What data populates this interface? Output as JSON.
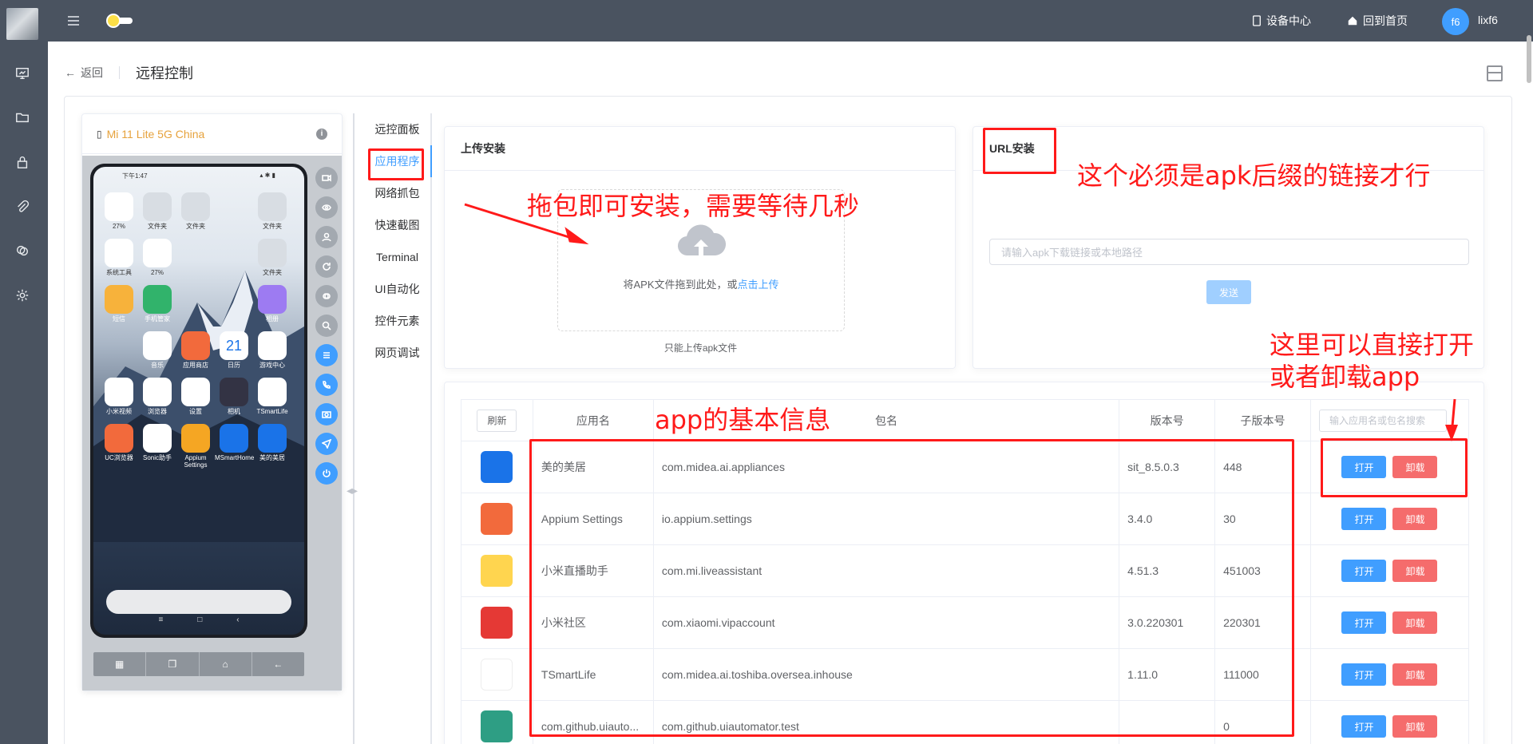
{
  "topbar": {
    "device_center": "设备中心",
    "home": "回到首页",
    "avatar_text": "f6",
    "username": "lixf6"
  },
  "breadcrumb": {
    "back": "返回",
    "title": "远程控制"
  },
  "device": {
    "name": "Mi 11 Lite 5G China",
    "status_time": "下午1:47",
    "apps": [
      {
        "label": "27%"
      },
      {
        "label": "文件夹"
      },
      {
        "label": "文件夹"
      },
      {
        "label": "文件夹"
      },
      {
        "label": "系统工具"
      },
      {
        "label": "27%"
      },
      {
        "label": "文件夹"
      },
      {
        "label": "短信"
      },
      {
        "label": "手机管家"
      },
      {
        "label": "相册"
      },
      {
        "label": "音乐"
      },
      {
        "label": "应用商店"
      },
      {
        "label": "日历"
      },
      {
        "label": "游戏中心"
      },
      {
        "label": "小米视频"
      },
      {
        "label": "浏览器"
      },
      {
        "label": "设置"
      },
      {
        "label": "相机"
      },
      {
        "label": "TSmartLife"
      },
      {
        "label": "UC浏览器"
      },
      {
        "label": "Sonic助手"
      },
      {
        "label": "Appium Settings"
      },
      {
        "label": "MSmartHome"
      },
      {
        "label": "美的美居"
      }
    ],
    "calendar_day": "21"
  },
  "tabs": [
    {
      "label": "远控面板"
    },
    {
      "label": "应用程序"
    },
    {
      "label": "网络抓包"
    },
    {
      "label": "快速截图"
    },
    {
      "label": "Terminal"
    },
    {
      "label": "UI自动化"
    },
    {
      "label": "控件元素"
    },
    {
      "label": "网页调试"
    }
  ],
  "upload": {
    "title": "上传安装",
    "drop_text": "将APK文件拖到此处，或",
    "drop_link": "点击上传",
    "tip": "只能上传apk文件"
  },
  "url_install": {
    "title": "URL安装",
    "placeholder": "请输入apk下载链接或本地路径",
    "send": "发送"
  },
  "table": {
    "refresh": "刷新",
    "headers": {
      "app_name": "应用名",
      "package": "包名",
      "version": "版本号",
      "sub_version": "子版本号"
    },
    "search_placeholder": "输入应用名或包名搜索",
    "open": "打开",
    "uninstall": "卸载",
    "rows": [
      {
        "name": "美的美居",
        "package": "com.midea.ai.appliances",
        "version": "sit_8.5.0.3",
        "sub": "448",
        "color": "#1a73e8"
      },
      {
        "name": "Appium Settings",
        "package": "io.appium.settings",
        "version": "3.4.0",
        "sub": "30",
        "color": "#f26a3c"
      },
      {
        "name": "小米直播助手",
        "package": "com.mi.liveassistant",
        "version": "4.51.3",
        "sub": "451003",
        "color": "#ffd54f"
      },
      {
        "name": "小米社区",
        "package": "com.xiaomi.vipaccount",
        "version": "3.0.220301",
        "sub": "220301",
        "color": "#e53935"
      },
      {
        "name": "TSmartLife",
        "package": "com.midea.ai.toshiba.oversea.inhouse",
        "version": "1.11.0",
        "sub": "111000",
        "color": "#ffffff"
      },
      {
        "name": "com.github.uiauto...",
        "package": "com.github.uiautomator.test",
        "version": "",
        "sub": "0",
        "color": "#2e9e84"
      }
    ]
  },
  "annotations": {
    "drag_install": "拖包即可安装，需要等待几秒",
    "url_note": "这个必须是apk后缀的链接才行",
    "direct_open_line1": "这里可以直接打开",
    "direct_open_line2": "或者卸载app",
    "basic_info": "app的基本信息"
  },
  "colors": {
    "primary": "#409eff",
    "danger": "#f56c6c",
    "sidebar": "#4a5360",
    "annotation": "#ff1a1a",
    "device_name": "#e6a23c"
  }
}
